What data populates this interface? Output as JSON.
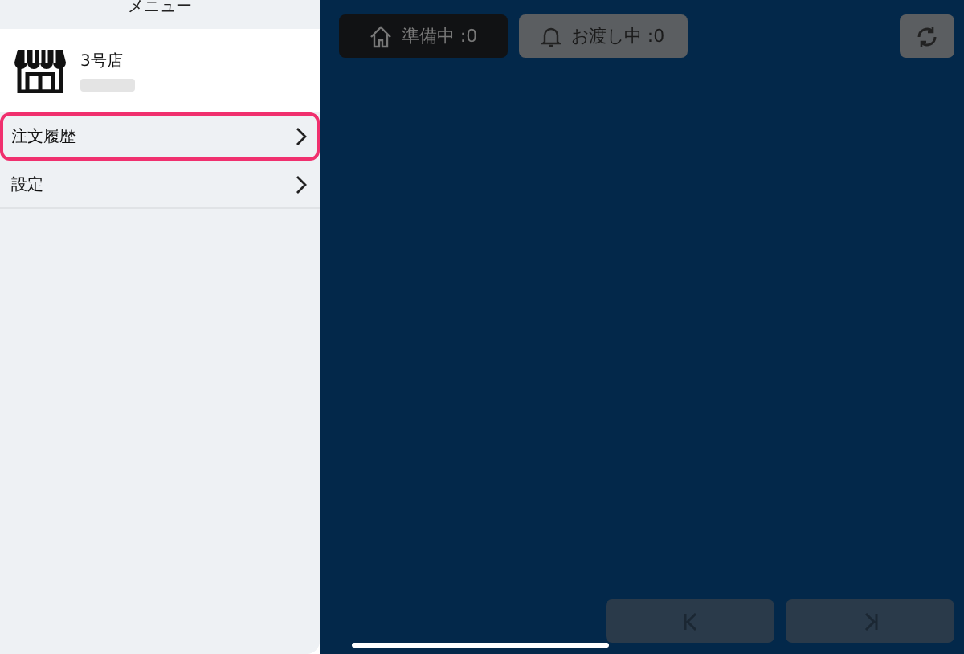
{
  "menu": {
    "title": "メニュー",
    "store": {
      "name": "3号店"
    },
    "items": [
      {
        "label": "注文履歴",
        "selected": true
      },
      {
        "label": "設定",
        "selected": false
      }
    ]
  },
  "tabs": [
    {
      "kind": "home",
      "label": "準備中 :0",
      "selected": true
    },
    {
      "kind": "bell",
      "label": "お渡し中 :0",
      "selected": false
    }
  ],
  "pager": [
    {
      "kind": "first"
    },
    {
      "kind": "last"
    }
  ]
}
